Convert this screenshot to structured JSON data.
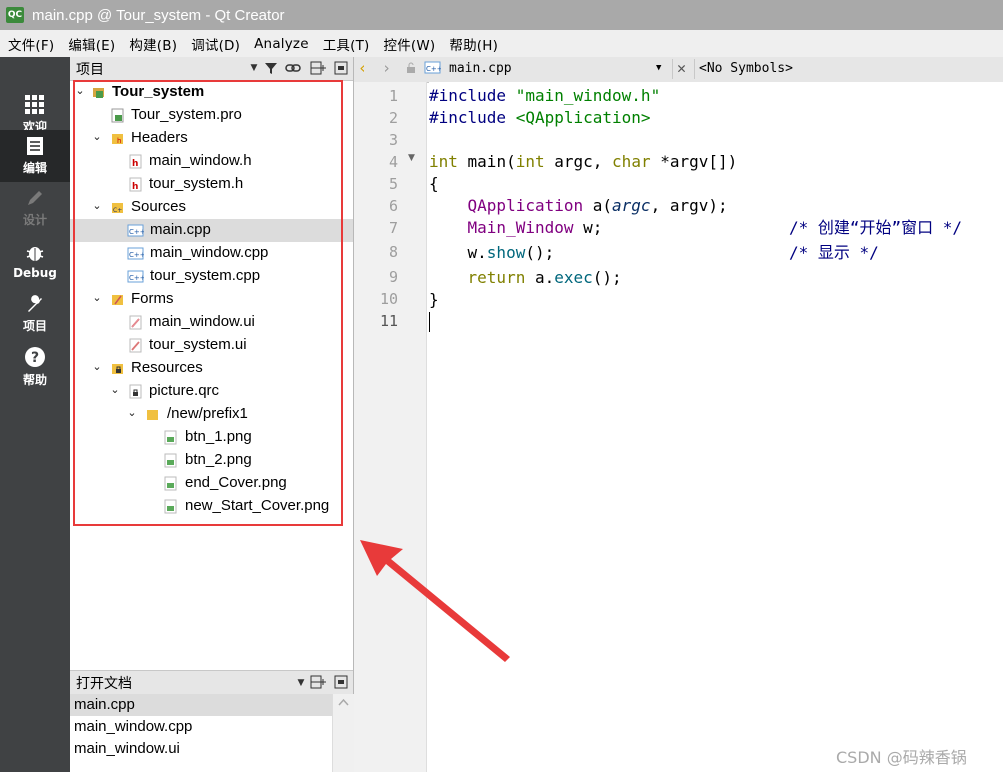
{
  "window": {
    "title": "main.cpp @ Tour_system - Qt Creator",
    "logo": "QC"
  },
  "menu": [
    "文件(F)",
    "编辑(E)",
    "构建(B)",
    "调试(D)",
    "Analyze",
    "工具(T)",
    "控件(W)",
    "帮助(H)"
  ],
  "modes": [
    {
      "label": "欢迎",
      "icon": "grid-icon"
    },
    {
      "label": "编辑",
      "icon": "document-icon"
    },
    {
      "label": "设计",
      "icon": "pencil-icon"
    },
    {
      "label": "Debug",
      "icon": "bug-icon"
    },
    {
      "label": "项目",
      "icon": "wrench-icon"
    },
    {
      "label": "帮助",
      "icon": "help-icon"
    }
  ],
  "project_panel": {
    "title": "项目"
  },
  "tree": [
    {
      "label": "Tour_system",
      "icon": "project-icon"
    },
    {
      "label": "Tour_system.pro",
      "icon": "pro-file-icon"
    },
    {
      "label": "Headers",
      "icon": "folder-h-icon"
    },
    {
      "label": "main_window.h",
      "icon": "header-file-icon"
    },
    {
      "label": "tour_system.h",
      "icon": "header-file-icon"
    },
    {
      "label": "Sources",
      "icon": "folder-cpp-icon"
    },
    {
      "label": "main.cpp",
      "icon": "cpp-file-icon"
    },
    {
      "label": "main_window.cpp",
      "icon": "cpp-file-icon"
    },
    {
      "label": "tour_system.cpp",
      "icon": "cpp-file-icon"
    },
    {
      "label": "Forms",
      "icon": "folder-ui-icon"
    },
    {
      "label": "main_window.ui",
      "icon": "ui-file-icon"
    },
    {
      "label": "tour_system.ui",
      "icon": "ui-file-icon"
    },
    {
      "label": "Resources",
      "icon": "folder-lock-icon"
    },
    {
      "label": "picture.qrc",
      "icon": "qrc-file-icon"
    },
    {
      "label": "/new/prefix1",
      "icon": "folder-icon"
    },
    {
      "label": "btn_1.png",
      "icon": "image-file-icon"
    },
    {
      "label": "btn_2.png",
      "icon": "image-file-icon"
    },
    {
      "label": "end_Cover.png",
      "icon": "image-file-icon"
    },
    {
      "label": "new_Start_Cover.png",
      "icon": "image-file-icon"
    }
  ],
  "open_docs": {
    "title": "打开文档",
    "items": [
      "main.cpp",
      "main_window.cpp",
      "main_window.ui"
    ]
  },
  "editor": {
    "file": "main.cpp",
    "symbols": "<No Symbols>"
  },
  "line_numbers": [
    "1",
    "2",
    "3",
    "4",
    "5",
    "6",
    "7",
    "8",
    "9",
    "10",
    "11"
  ],
  "code": {
    "l1_a": "#include ",
    "l1_b": "\"main_window.h\"",
    "l2_a": "#include ",
    "l2_b": "<QApplication>",
    "l4_a": "int",
    "l4_b": " main(",
    "l4_c": "int",
    "l4_d": " argc, ",
    "l4_e": "char",
    "l4_f": " *argv[])",
    "l5": "{",
    "l6_a": "    ",
    "l6_b": "QApplication",
    "l6_c": " a(",
    "l6_d": "argc",
    "l6_e": ", argv);",
    "l7_a": "    ",
    "l7_b": "Main_Window",
    "l7_c": " w;",
    "l7_d": "/* 创建“开始”窗口 */",
    "l8_a": "    w.",
    "l8_b": "show",
    "l8_c": "();",
    "l8_d": "/* 显示 */",
    "l9_a": "    ",
    "l9_b": "return",
    "l9_c": " a.",
    "l9_d": "exec",
    "l9_e": "();",
    "l10": "}"
  },
  "watermark": "CSDN @码辣香锅",
  "colors": {
    "annotation": "#e83a3a",
    "sidebar": "#404244"
  }
}
